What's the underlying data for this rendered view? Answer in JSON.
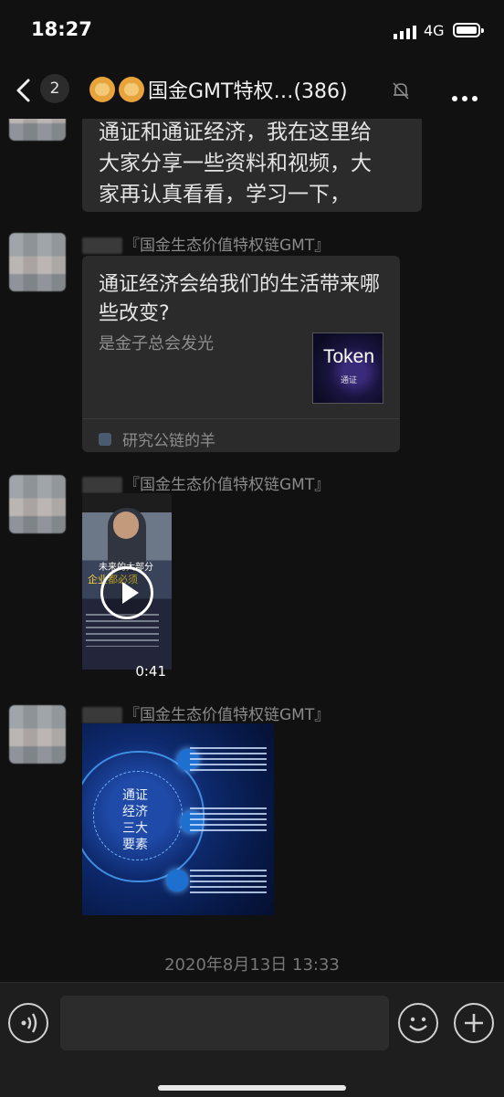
{
  "status_bar": {
    "time": "18:27",
    "network": "4G"
  },
  "nav": {
    "unread_count": "2",
    "title": "国金GMT特权…(386)",
    "icons": [
      "back-icon",
      "lion-emoji-icon",
      "mute-bell-icon",
      "more-icon"
    ]
  },
  "messages": [
    {
      "type": "text",
      "text_lines": [
        "通证和通证经济，我在这里给",
        "大家分享一些资料和视频，大",
        "家再认真看看，学习一下，"
      ]
    },
    {
      "type": "link-card",
      "sender": "『国金生态价值特权链GMT』",
      "title": "通证经济会给我们的生活带来哪些改变?",
      "desc": "是金子总会发光",
      "thumb_text": "Token",
      "thumb_subtext": "通证",
      "source": "研究公链的羊"
    },
    {
      "type": "video",
      "sender": "『国金生态价值特权链GMT』",
      "caption_top": "未来的大部分",
      "caption_highlight": "企业都必须",
      "duration": "0:41"
    },
    {
      "type": "image",
      "sender": "『国金生态价值特权链GMT』",
      "center_text": "通证经济三大要素"
    }
  ],
  "timestamp": "2020年8月13日 13:33",
  "input_bar": {
    "icons": [
      "voice-icon",
      "emoji-icon",
      "plus-icon"
    ],
    "placeholder": ""
  }
}
